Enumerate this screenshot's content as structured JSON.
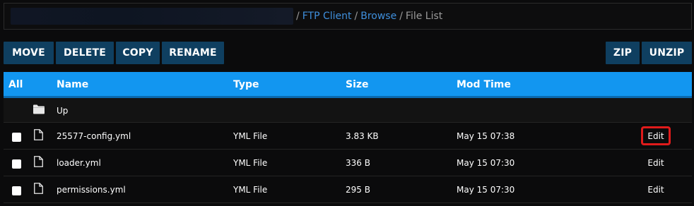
{
  "breadcrumb": {
    "separator": "/",
    "items": [
      "FTP Client",
      "Browse"
    ],
    "current": "File List"
  },
  "toolbar": {
    "move": "MOVE",
    "delete": "DELETE",
    "copy": "COPY",
    "rename": "RENAME",
    "zip": "ZIP",
    "unzip": "UNZIP"
  },
  "table": {
    "headers": {
      "all": "All",
      "name": "Name",
      "type": "Type",
      "size": "Size",
      "mod_time": "Mod Time"
    },
    "up_label": "Up",
    "rows": [
      {
        "name": "25577-config.yml",
        "type": "YML File",
        "size": "3.83 KB",
        "mod_time": "May 15 07:38",
        "action": "Edit"
      },
      {
        "name": "loader.yml",
        "type": "YML File",
        "size": "336 B",
        "mod_time": "May 15 07:30",
        "action": "Edit"
      },
      {
        "name": "permissions.yml",
        "type": "YML File",
        "size": "295 B",
        "mod_time": "May 15 07:30",
        "action": "Edit"
      }
    ]
  },
  "colors": {
    "header_bg": "#1296f0",
    "button_bg": "#0f3f60",
    "link": "#3f8fdc",
    "highlight": "#e01b1b"
  },
  "icons": {
    "up": "folder-icon",
    "file": "file-icon"
  }
}
